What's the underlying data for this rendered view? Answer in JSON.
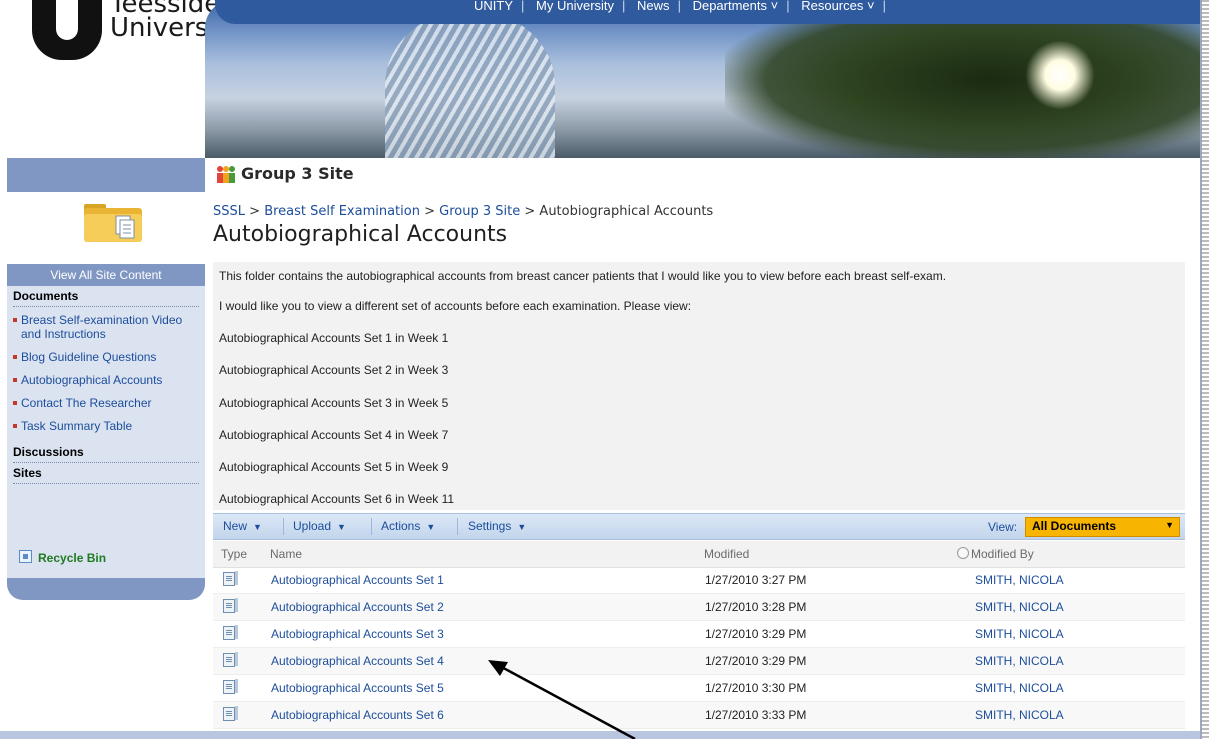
{
  "banner": {
    "logo_line1": "Teesside",
    "logo_line2": "University",
    "nav": [
      "UNITY",
      "My University",
      "News",
      "Departments ˅",
      "Resources ˅"
    ]
  },
  "site": {
    "title": "Group 3 Site"
  },
  "breadcrumb": {
    "items": [
      "SSSL",
      "Breast Self Examination",
      "Group 3 Site"
    ],
    "separator": ">",
    "current": "Autobiographical Accounts"
  },
  "page_title": "Autobiographical Accounts",
  "left_nav": {
    "view_all": "View All Site Content",
    "documents_heading": "Documents",
    "documents": [
      "Breast Self-examination Video and Instructions",
      "Blog Guideline Questions",
      "Autobiographical Accounts",
      "Contact The Researcher",
      "Task Summary Table"
    ],
    "discussions_heading": "Discussions",
    "sites_heading": "Sites",
    "recycle_bin": "Recycle Bin"
  },
  "description": [
    "This folder contains the autobiographical accounts from breast cancer patients that I would like you to view before each breast self-exam.",
    "I would like you to view a different set of accounts before each examination. Please view:",
    "Autobiographical Accounts Set 1 in Week 1",
    "Autobiographical Accounts Set 2 in Week 3",
    "Autobiographical Accounts Set 3 in Week 5",
    "Autobiographical Accounts Set 4 in Week 7",
    "Autobiographical Accounts Set 5 in Week 9",
    "Autobiographical Accounts Set 6 in Week 11"
  ],
  "toolbar": {
    "new": "New",
    "upload": "Upload",
    "actions": "Actions",
    "settings": "Settings",
    "view_label": "View:",
    "view_value": "All Documents"
  },
  "list": {
    "columns": {
      "type": "Type",
      "name": "Name",
      "modified": "Modified",
      "modified_by": "Modified By"
    },
    "rows": [
      {
        "name": "Autobiographical Accounts Set 1",
        "modified": "1/27/2010 3:27 PM",
        "modified_by": "SMITH, NICOLA"
      },
      {
        "name": "Autobiographical Accounts Set 2",
        "modified": "1/27/2010 3:28 PM",
        "modified_by": "SMITH, NICOLA"
      },
      {
        "name": "Autobiographical Accounts Set 3",
        "modified": "1/27/2010 3:29 PM",
        "modified_by": "SMITH, NICOLA"
      },
      {
        "name": "Autobiographical Accounts Set 4",
        "modified": "1/27/2010 3:29 PM",
        "modified_by": "SMITH, NICOLA"
      },
      {
        "name": "Autobiographical Accounts Set 5",
        "modified": "1/27/2010 3:30 PM",
        "modified_by": "SMITH, NICOLA"
      },
      {
        "name": "Autobiographical Accounts Set 6",
        "modified": "1/27/2010 3:33 PM",
        "modified_by": "SMITH, NICOLA"
      }
    ]
  },
  "colors": {
    "link": "#1c4d9b",
    "nav_bar": "#7f97c2",
    "left_panel": "#dbe3f1",
    "view_select": "#f7b400",
    "recycle": "#207a20"
  },
  "icons": {
    "site": "people-group-icon",
    "folder": "folder-documents-icon",
    "doc": "document-icon",
    "recycle": "recycle-bin-icon"
  }
}
